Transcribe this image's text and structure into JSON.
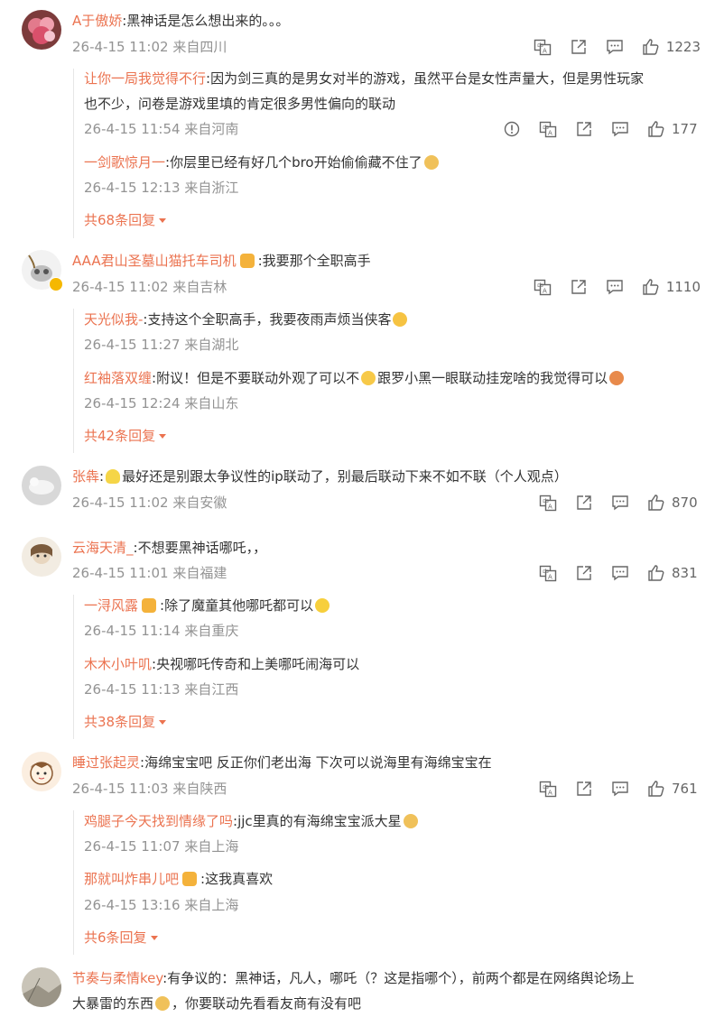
{
  "comments": [
    {
      "user": "A于傲娇",
      "text": ":黑神话是怎么想出来的。。。",
      "time": "26-4-15 11:02",
      "loc": "来自四川",
      "likes": "1223",
      "replies": [
        {
          "user": "让你一局我觉得不行",
          "text": ":因为剑三真的是男女对半的游戏，虽然平台是女性声量大，但是男性玩家",
          "text2": "也不少，问卷是游戏里填的肯定很多男性偏向的联动",
          "time": "26-4-15 11:54",
          "loc": "来自河南",
          "likes": "177"
        },
        {
          "user": "一剑歌惊月一",
          "text": ":你层里已经有好几个bro开始偷偷藏不住了",
          "time": "26-4-15 12:13",
          "loc": "来自浙江"
        }
      ],
      "more": "共68条回复"
    },
    {
      "user": "AAA君山圣墓山猫托车司机",
      "text": ":我要那个全职高手",
      "time": "26-4-15 11:02",
      "loc": "来自吉林",
      "likes": "1110",
      "replies": [
        {
          "user": "天光似我-",
          "text": ":支持这个全职高手，我要夜雨声烦当侠客",
          "time": "26-4-15 11:27",
          "loc": "来自湖北"
        },
        {
          "user": "红袖落双缠",
          "text": ":附议！但是不要联动外观了可以不",
          "text_b": "跟罗小黑一眼联动挂宠啥的我觉得可以",
          "time": "26-4-15 12:24",
          "loc": "来自山东"
        }
      ],
      "more": "共42条回复"
    },
    {
      "user": "张犇",
      "text": "最好还是别跟太争议性的ip联动了，别最后联动下来不如不联（个人观点）",
      "time": "26-4-15 11:02",
      "loc": "来自安徽",
      "likes": "870"
    },
    {
      "user": "云海天清_",
      "text": ":不想要黑神话哪吒，，",
      "time": "26-4-15 11:01",
      "loc": "来自福建",
      "likes": "831",
      "replies": [
        {
          "user": "一浔风露",
          "text": ":除了魔童其他哪吒都可以",
          "time": "26-4-15 11:14",
          "loc": "来自重庆"
        },
        {
          "user": "木木小叶叽",
          "text": ":央视哪吒传奇和上美哪吒闹海可以",
          "time": "26-4-15 11:13",
          "loc": "来自江西"
        }
      ],
      "more": "共38条回复"
    },
    {
      "user": "睡过张起灵",
      "text": ":海绵宝宝吧 反正你们老出海 下次可以说海里有海绵宝宝在",
      "time": "26-4-15 11:03",
      "loc": "来自陕西",
      "likes": "761",
      "replies": [
        {
          "user": "鸡腿子今天找到情缘了吗",
          "text": ":jjc里真的有海绵宝宝派大星",
          "time": "26-4-15 11:07",
          "loc": "来自上海"
        },
        {
          "user": "那就叫炸串儿吧",
          "text": ":这我真喜欢",
          "time": "26-4-15 13:16",
          "loc": "来自上海"
        }
      ],
      "more": "共6条回复"
    },
    {
      "user": "节奏与柔情key",
      "text": ":有争议的：黑神话，凡人，哪吒（？这是指哪个），前两个都是在网络舆论场上",
      "text2": "大暴雷的东西",
      "text2b": "，你要联动先看看友商有没有吧"
    }
  ],
  "colors": {
    "username": "#eb7350",
    "meta": "#939393",
    "text": "#333333"
  }
}
